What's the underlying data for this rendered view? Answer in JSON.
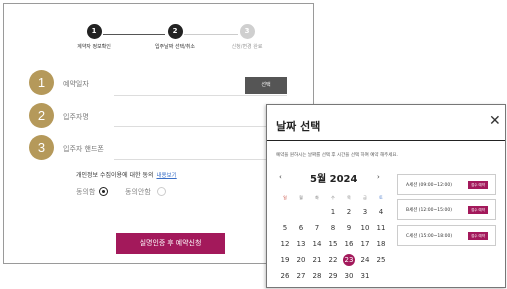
{
  "steps": [
    {
      "number": "1",
      "label": "계약자 정보확인",
      "color": "#222222"
    },
    {
      "number": "2",
      "label": "입주날짜 선택/취소",
      "color": "#222222"
    },
    {
      "number": "3",
      "label": "신청/변경 완료",
      "color": "#cfcfcf"
    }
  ],
  "form": {
    "fields": [
      {
        "number": "1",
        "label": "예약일자"
      },
      {
        "number": "2",
        "label": "입주자명"
      },
      {
        "number": "3",
        "label": "입주자 핸드폰"
      }
    ],
    "confirm_label": "선택",
    "consent_text": "개인정보 수집이용에 대한 동의",
    "consent_link": "내용보기",
    "agree_label": "동의함",
    "disagree_label": "동의안함",
    "agree_selected": true,
    "submit_label": "실명인증 후 예약신청",
    "accent": "#a3195b",
    "badge_color": "#b5995a"
  },
  "modal": {
    "title": "날짜 선택",
    "close_icon": "close-icon",
    "description": "예약을 원하시는 날짜를 선택 후 시간을 선택 하여 예약 해주세요.",
    "calendar": {
      "month_label": "5월 2024",
      "prev": "‹",
      "next": "›",
      "weekdays": [
        "일",
        "월",
        "화",
        "수",
        "목",
        "금",
        "토"
      ],
      "weeks": [
        [
          "",
          "",
          "",
          "1",
          "2",
          "3",
          "4"
        ],
        [
          "5",
          "6",
          "7",
          "8",
          "9",
          "10",
          "11"
        ],
        [
          "12",
          "13",
          "14",
          "15",
          "16",
          "17",
          "18"
        ],
        [
          "19",
          "20",
          "21",
          "22",
          "23",
          "24",
          "25"
        ],
        [
          "26",
          "27",
          "28",
          "29",
          "30",
          "31",
          ""
        ]
      ],
      "selected": "23"
    },
    "slots": [
      {
        "label": "A세션 (09:00~12:00)",
        "button": "접수 예약"
      },
      {
        "label": "B세션 (12:00~15:00)",
        "button": "접수 예약"
      },
      {
        "label": "C세션 (15:00~18:00)",
        "button": "접수 예약"
      }
    ]
  }
}
